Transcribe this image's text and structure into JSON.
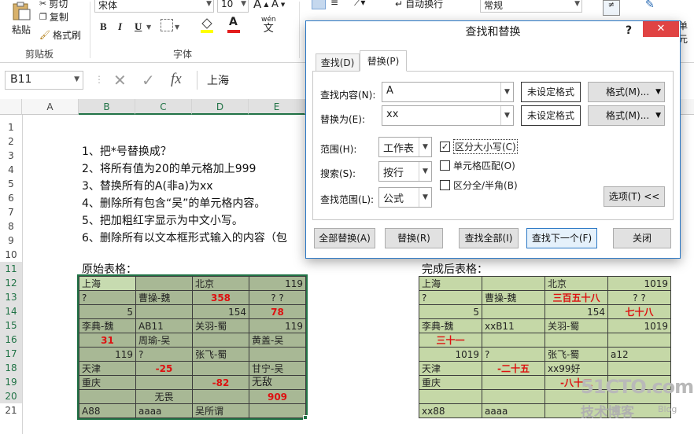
{
  "ribbon": {
    "clipboard_group": "剪贴板",
    "paste": "粘贴",
    "cut": "剪切",
    "copy": "复制",
    "format_painter": "格式刷",
    "font_group": "字体",
    "font_name": "宋体",
    "font_size": "10",
    "grow_font": "A",
    "shrink_font": "A",
    "wen": "wén",
    "wen_char": "文",
    "wrap_text": "自动换行",
    "number_format": "常规",
    "right_clip": "单元",
    "bold": "B",
    "italic": "I",
    "underline": "U"
  },
  "formula_bar": {
    "name_box": "B11",
    "fx": "fx",
    "content": "上海"
  },
  "columns": [
    "A",
    "B",
    "C",
    "D",
    "E"
  ],
  "rows": [
    "1",
    "2",
    "3",
    "4",
    "5",
    "6",
    "7",
    "8",
    "9",
    "10",
    "11",
    "12",
    "13",
    "14",
    "15",
    "16",
    "17",
    "18",
    "19",
    "20",
    "21"
  ],
  "instructions": [
    "1、把*号替换成？",
    "2、将所有值为20的单元格加上999",
    "3、替换所有的A(非a)为xx",
    "4、删除所有包含“吴”的单元格内容。",
    "5、把加粗红字显示为中文小写。",
    "6、删除所有以文本框形式输入的内容（包"
  ],
  "original_label": "原始表格：",
  "result_label": "完成后表格：",
  "original_table": [
    [
      "上海",
      "",
      "北京",
      "119"
    ],
    [
      "?",
      "曹操-魏",
      "358",
      "? ?"
    ],
    [
      "5",
      "",
      "154",
      "78"
    ],
    [
      "李典-魏",
      "AB11",
      "关羽-蜀",
      "119"
    ],
    [
      "31",
      "周瑜-吴",
      "",
      "黄盖-吴"
    ],
    [
      "119",
      "?",
      "张飞-蜀",
      ""
    ],
    [
      "天津",
      "-25",
      "",
      "甘宁-吴"
    ],
    [
      "重庆",
      "",
      "-82",
      "无敌"
    ],
    [
      "",
      "无畏",
      "",
      "909"
    ],
    [
      "A88",
      "aaaa",
      "吴所谓",
      ""
    ]
  ],
  "result_table": [
    [
      "上海",
      "",
      "北京",
      "1019"
    ],
    [
      "?",
      "曹操-魏",
      "三百五十八",
      "? ?"
    ],
    [
      "5",
      "",
      "154",
      "七十八"
    ],
    [
      "李典-魏",
      "xxB11",
      "关羽-蜀",
      "1019"
    ],
    [
      "三十一",
      "",
      "",
      ""
    ],
    [
      "1019",
      "?",
      "张飞-蜀",
      "a12"
    ],
    [
      "天津",
      "-二十五",
      "xx99好",
      ""
    ],
    [
      "重庆",
      "",
      "-八十二",
      ""
    ],
    [
      "",
      "",
      "",
      ""
    ],
    [
      "xx88",
      "aaaa",
      "",
      ""
    ]
  ],
  "dialog": {
    "title": "查找和替换",
    "help": "?",
    "close": "✕",
    "tab_find": "查找(D)",
    "tab_replace": "替换(P)",
    "find_label": "查找内容(N):",
    "find_value": "A",
    "replace_label": "替换为(E):",
    "replace_value": "xx",
    "no_format": "未设定格式",
    "format_btn": "格式(M)...",
    "scope_label": "范围(H):",
    "scope_value": "工作表",
    "search_label": "搜索(S):",
    "search_value": "按行",
    "lookin_label": "查找范围(L):",
    "lookin_value": "公式",
    "match_case": "区分大小写(C)",
    "match_cell": "单元格匹配(O)",
    "match_width": "区分全/半角(B)",
    "options_btn": "选项(T) <<",
    "replace_all": "全部替换(A)",
    "replace": "替换(R)",
    "find_all": "查找全部(I)",
    "find_next": "查找下一个(F)",
    "close_btn": "关闭"
  },
  "watermark": {
    "site": "51CTO.com",
    "sub": "技术博客",
    "blog": "Blog"
  },
  "colors": {
    "cell_green": "#c5d8a7",
    "cell_gray_green": "#bfcda9",
    "accent": "#217346",
    "dialog_border": "#2b78c5",
    "red_text": "#dd1111"
  }
}
